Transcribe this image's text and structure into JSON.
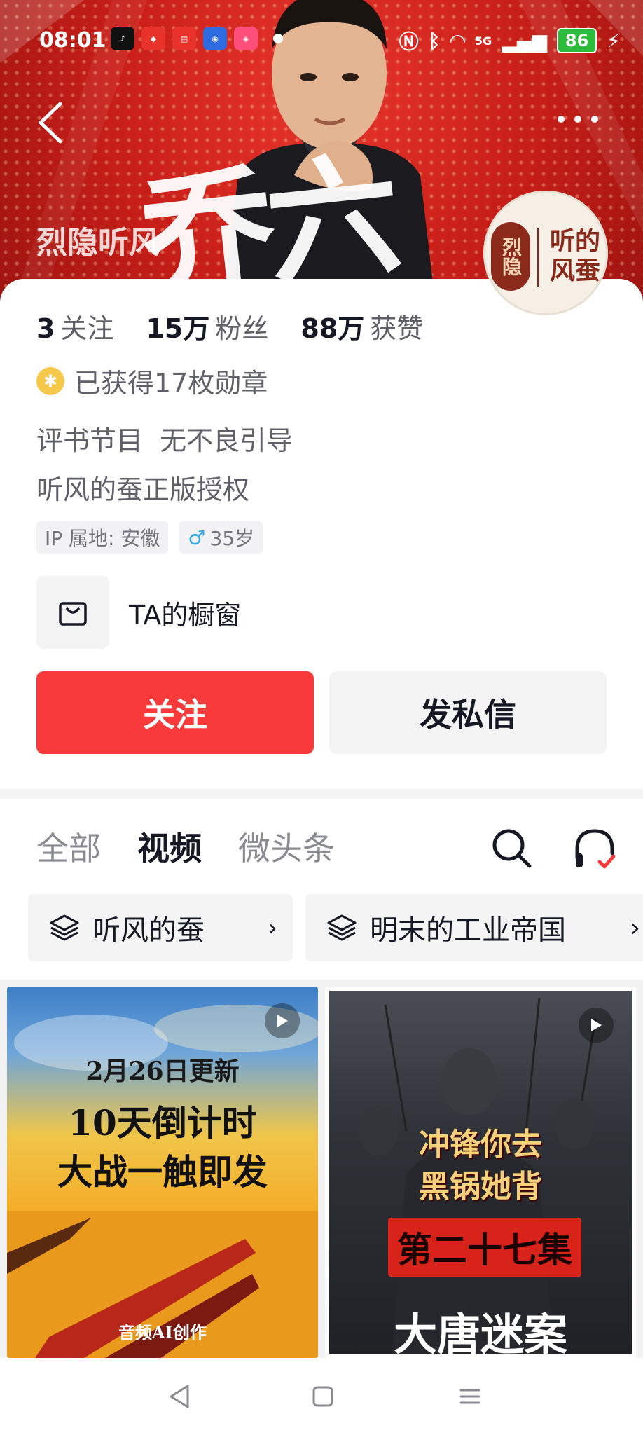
{
  "status_bar": {
    "time": "08:01",
    "battery": "86",
    "network": "5G"
  },
  "banner": {
    "name": "烈隐听风",
    "brush_text": "乔六",
    "logo_seal": "烈隐",
    "logo_text": "听的风蚕"
  },
  "profile": {
    "following_count": "3",
    "following_label": "关注",
    "followers_count": "15万",
    "followers_label": "粉丝",
    "likes_count": "88万",
    "likes_label": "获赞",
    "medals": "已获得17枚勋章",
    "bio_line1": "评书节目  无不良引导",
    "bio_line2": "听风的蚕正版授权",
    "tag_ip": "IP 属地: 安徽",
    "tag_age": "35岁",
    "shop_label": "TA的橱窗",
    "follow_button": "关注",
    "message_button": "发私信"
  },
  "tabs": [
    {
      "label": "全部",
      "active": false
    },
    {
      "label": "视频",
      "active": true
    },
    {
      "label": "微头条",
      "active": false
    }
  ],
  "collections": [
    {
      "label": "听风的蚕"
    },
    {
      "label": "明末的工业帝国"
    }
  ],
  "videos": [
    {
      "date": "2月26日更新",
      "headline_line1": "10天倒计时",
      "headline_line2": "大战一触即发",
      "footer": "音频AI创作"
    },
    {
      "headline_line1": "冲锋你去",
      "headline_line2": "黑锅她背",
      "episode": "第二十七集",
      "title": "大唐迷案"
    }
  ],
  "colors": {
    "accent_red": "#f83a3a",
    "banner_red": "#c81e18",
    "text_primary": "#161823",
    "text_secondary": "#5f6068"
  }
}
